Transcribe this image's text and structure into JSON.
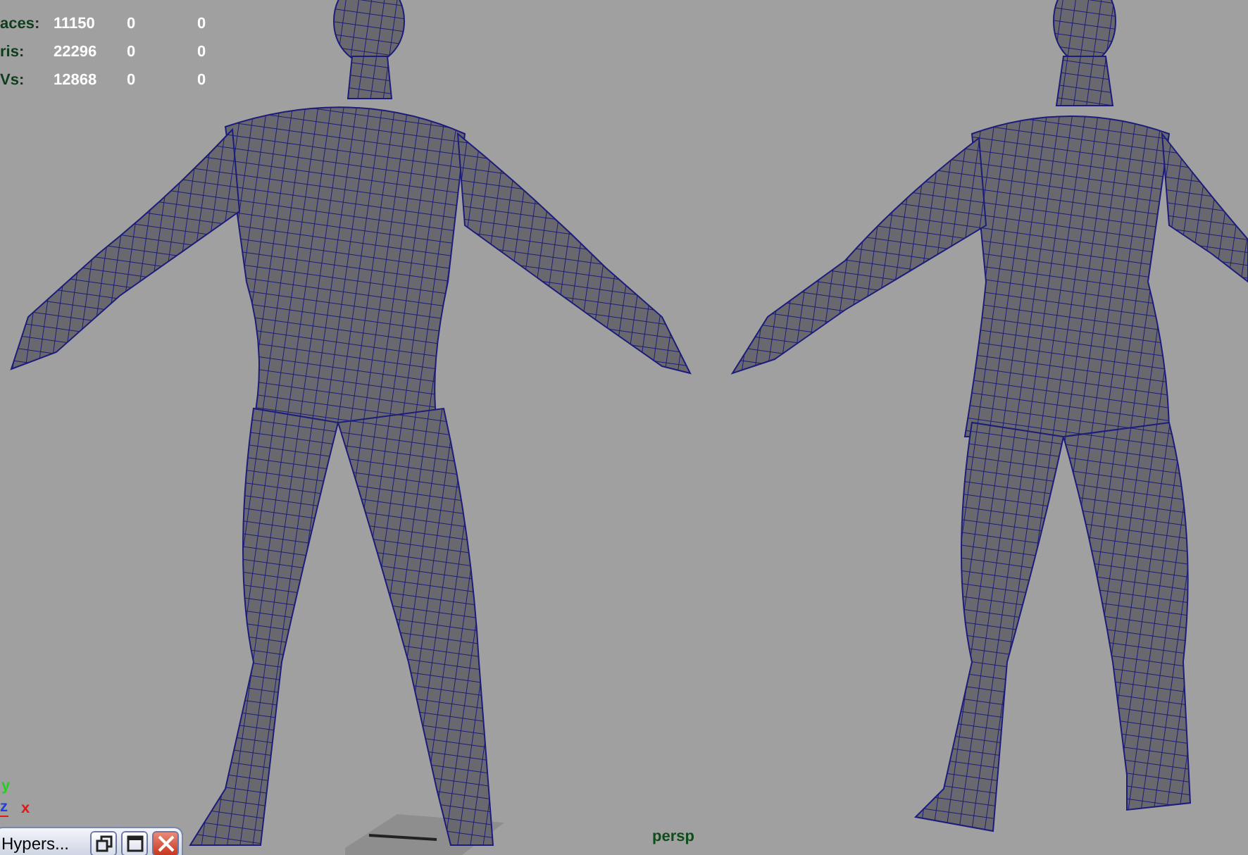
{
  "hud": {
    "rows": [
      {
        "label": "aces:",
        "values": [
          "11150",
          "0",
          "0"
        ]
      },
      {
        "label": "ris:",
        "values": [
          "22296",
          "0",
          "0"
        ]
      },
      {
        "label": "Vs:",
        "values": [
          "12868",
          "0",
          "0"
        ]
      }
    ]
  },
  "axis": {
    "labels": [
      {
        "text": "y",
        "color": "#1fd21f"
      },
      {
        "text": "z",
        "color": "#2040e0"
      },
      {
        "text": "x",
        "color": "#e01818"
      }
    ]
  },
  "camera_label": "persp",
  "minimized_window": {
    "title": "Hypers...",
    "buttons": [
      {
        "kind": "restore"
      },
      {
        "kind": "maximize"
      },
      {
        "kind": "close"
      }
    ]
  }
}
